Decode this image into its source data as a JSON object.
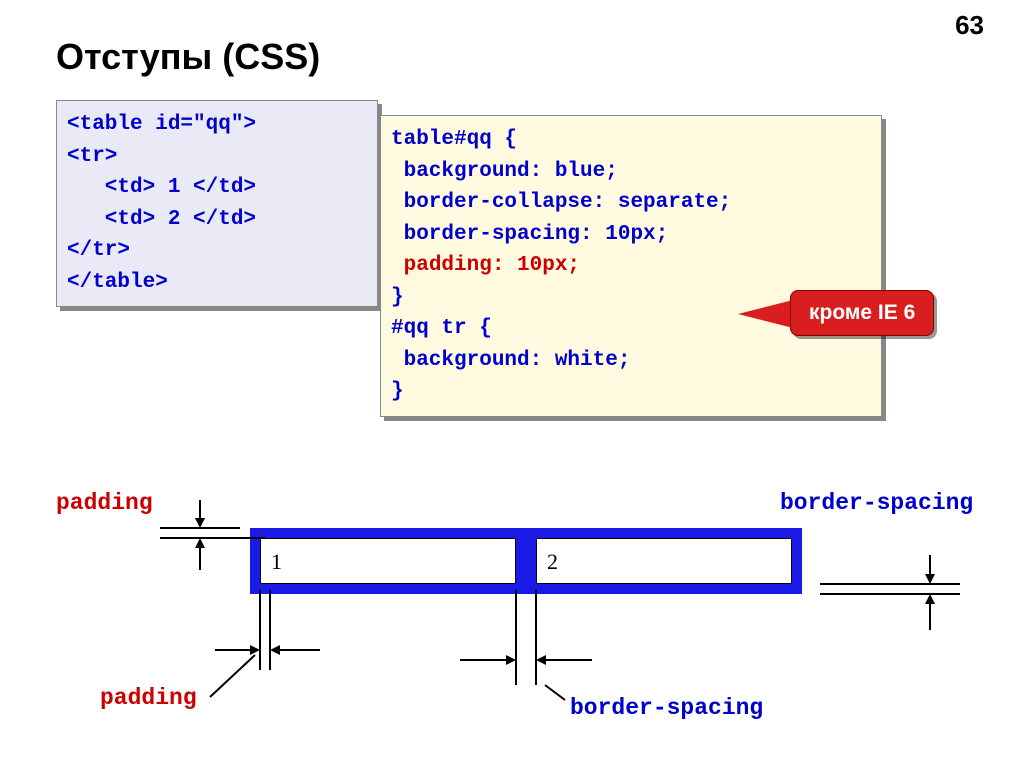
{
  "page_number": "63",
  "title": "Отступы (CSS)",
  "html_code": {
    "line1": "<table id=\"qq\">",
    "line2": "<tr>",
    "line3": "   <td> 1 </td>",
    "line4": "   <td> 2 </td>",
    "line5": "</tr>",
    "line6": "</table>"
  },
  "css_code": {
    "line1": "table#qq {",
    "line2": " background: blue;",
    "line3": " border-collapse: separate;",
    "line4": " border-spacing: 10px;",
    "line5_prefix": " ",
    "line5_hl": "padding: 10px;",
    "line6": "}",
    "line7": "#qq tr {",
    "line8": " background: white;",
    "line9": "}"
  },
  "callout": "кроме IE 6",
  "diagram": {
    "label_padding1": "padding",
    "label_padding2": "padding",
    "label_spacing1": "border-spacing",
    "label_spacing2": "border-spacing",
    "cell1": "1",
    "cell2": "2"
  }
}
